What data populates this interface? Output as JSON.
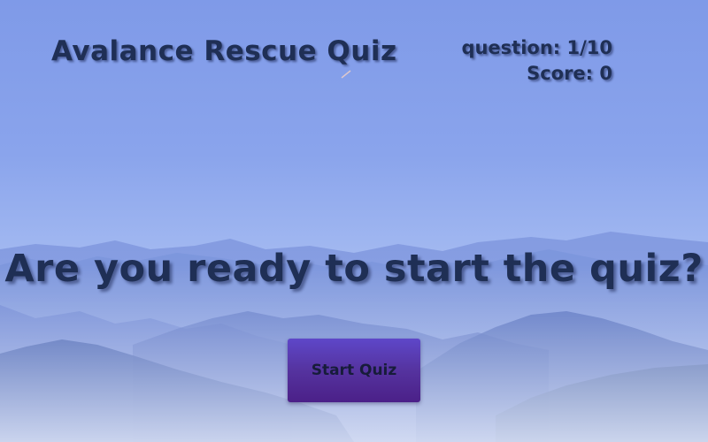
{
  "header": {
    "title": "Avalance Rescue Quiz",
    "question_label": "question: 1/10",
    "score_label": "Score: 0"
  },
  "main": {
    "prompt": "Are you ready to start the quiz?",
    "start_button_label": "Start Quiz"
  },
  "colors": {
    "text": "#1f2f55",
    "button": "#55339f",
    "sky": "#8aa4ec"
  }
}
